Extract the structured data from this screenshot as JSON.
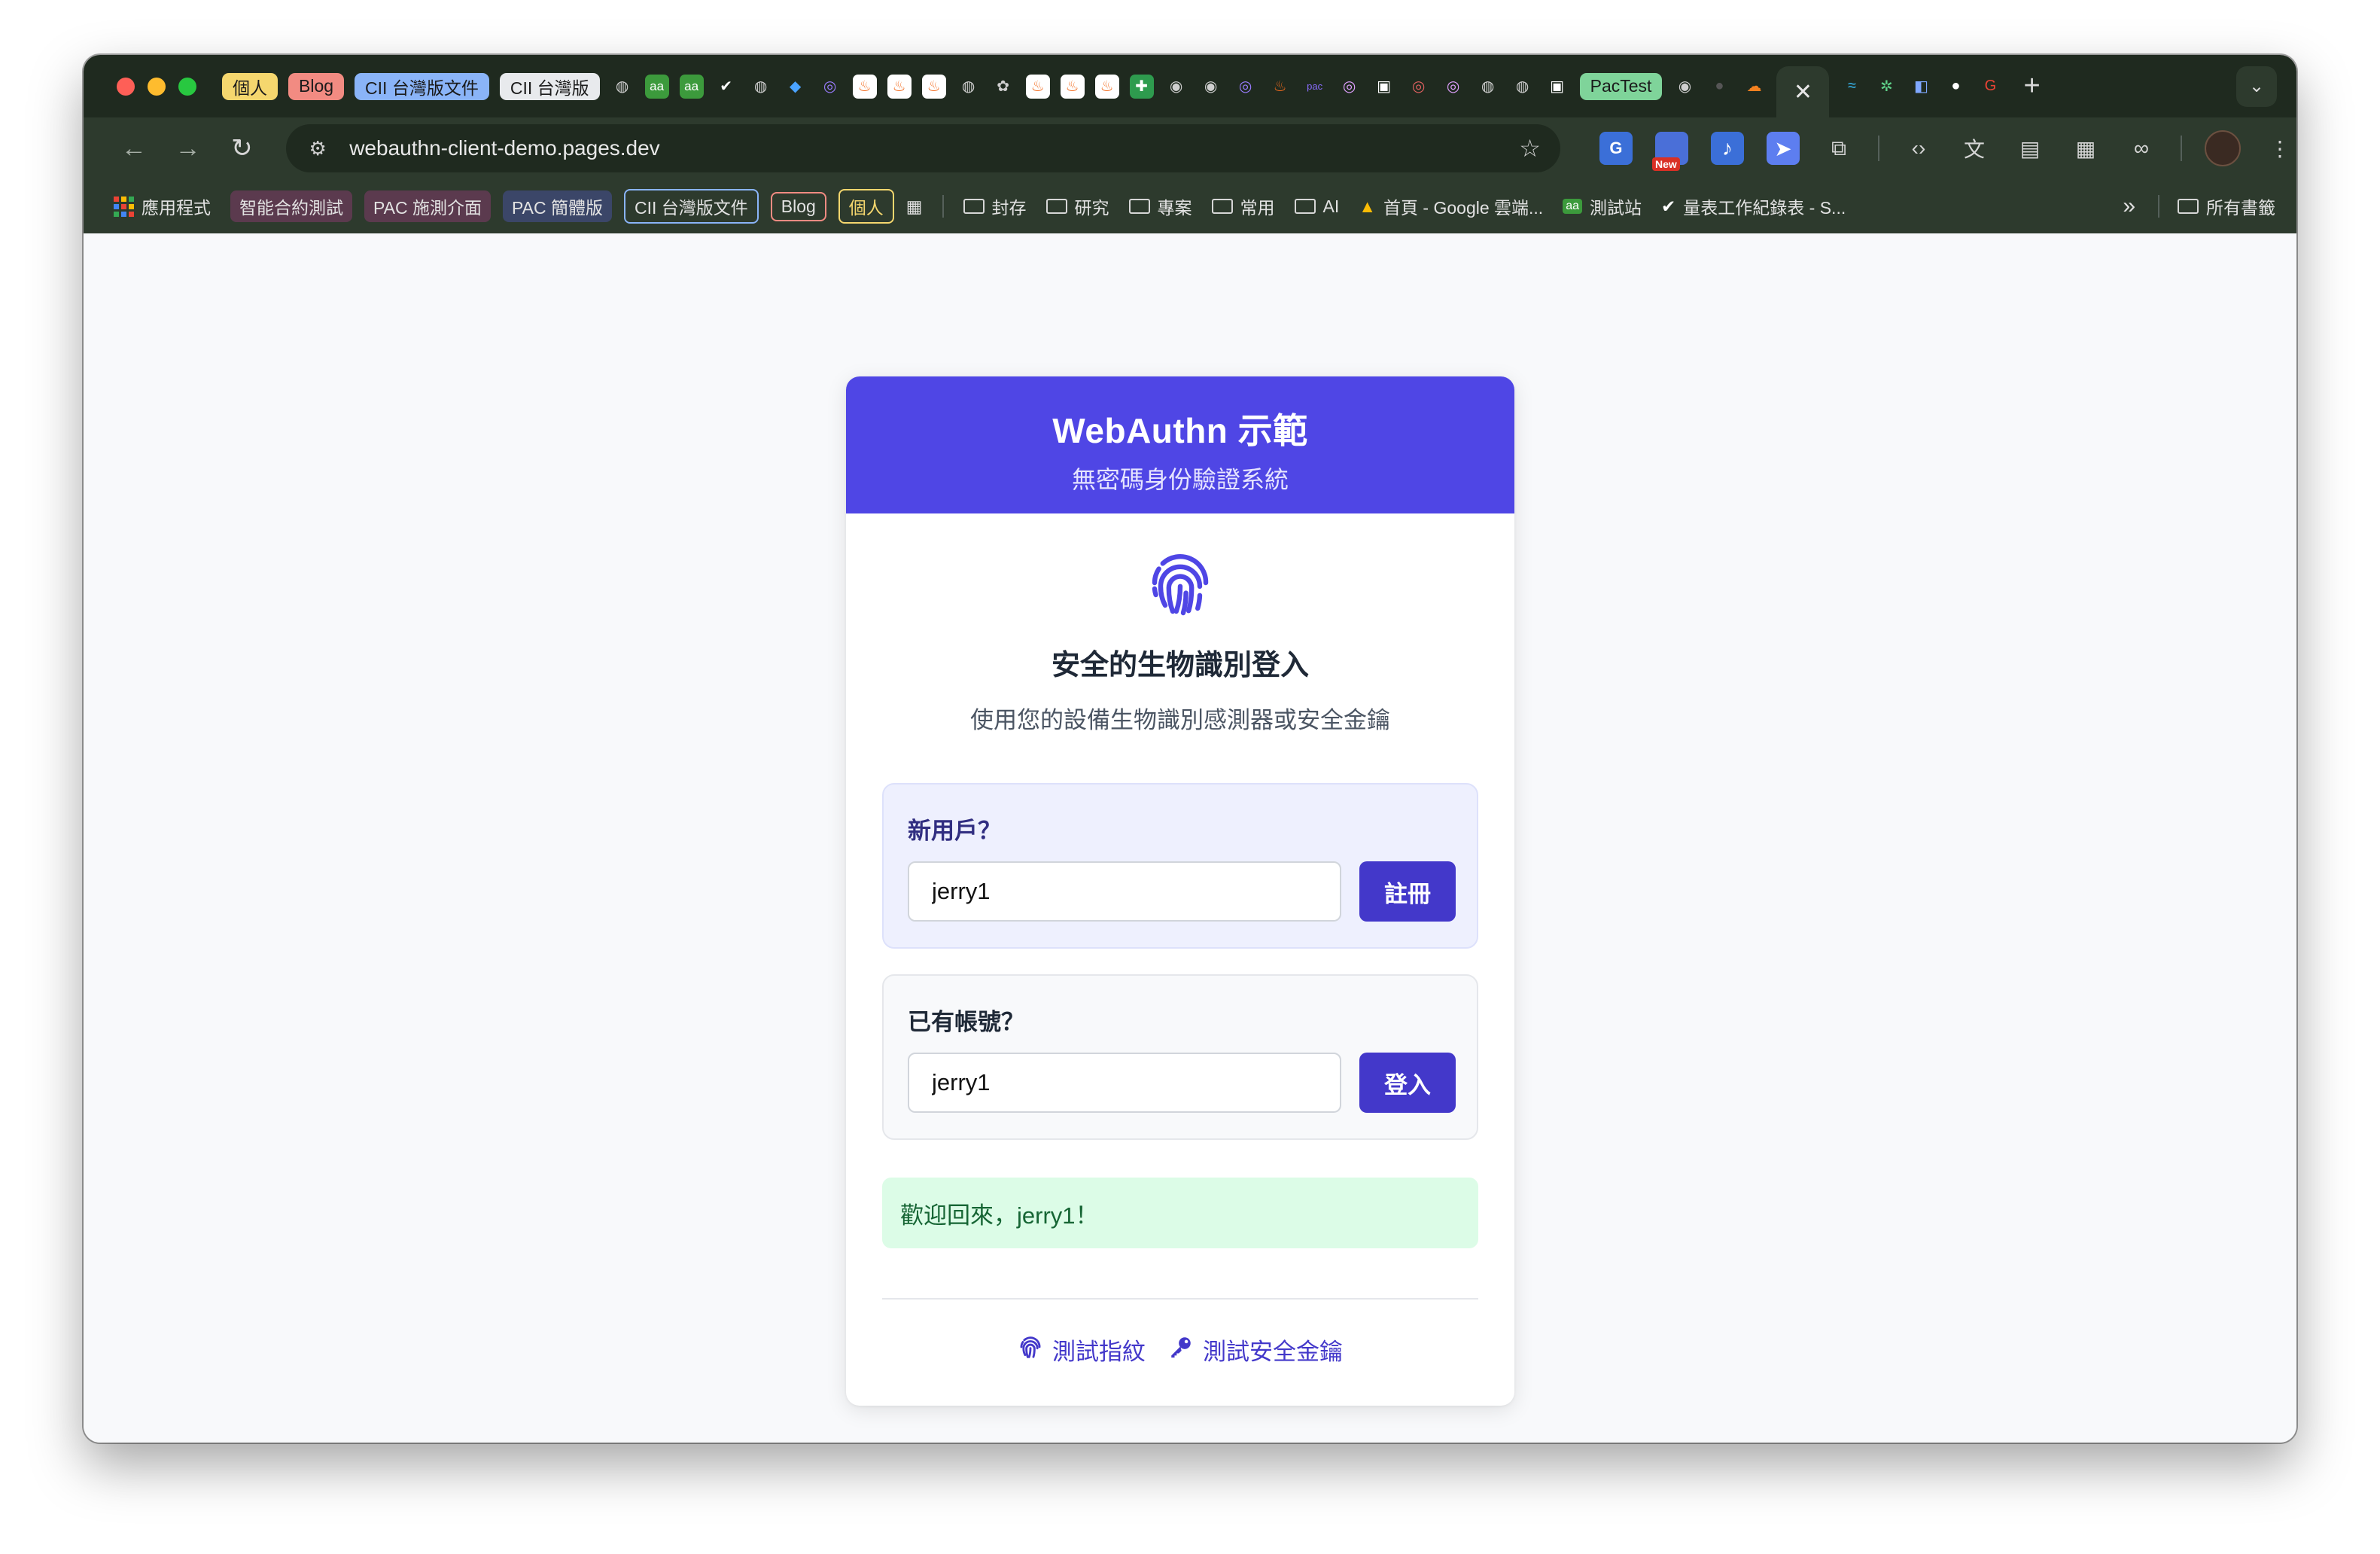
{
  "browser": {
    "colors": {
      "accent": "#4f46e5",
      "frame": "#1f2a1f",
      "toolbar": "#2d3a2d"
    },
    "tabs": {
      "group_chips": [
        {
          "label": "個人",
          "bg": "#f5d76e"
        },
        {
          "label": "Blog",
          "bg": "#f28b82"
        },
        {
          "label": "CII 台灣版文件",
          "bg": "#8ab4f8"
        },
        {
          "label": "CII 台灣版",
          "bg": "#e8eaed"
        }
      ],
      "pactest_label": "PacTest",
      "close_glyph": "✕",
      "new_tab_glyph": "+"
    },
    "address_bar": {
      "url": "webauthn-client-demo.pages.dev"
    },
    "extensions": {
      "new_badge": "New",
      "translate_label": "G"
    },
    "bookmarks": {
      "apps_label": "應用程式",
      "chips": [
        {
          "label": "智能合約測試",
          "bg": "#5b3a4e"
        },
        {
          "label": "PAC 施測介面",
          "bg": "#5b3a4e"
        },
        {
          "label": "PAC 簡體版",
          "bg": "#3b4668"
        },
        {
          "label": "CII 台灣版文件",
          "bg": "transparent",
          "border": "#8ab4f8"
        },
        {
          "label": "Blog",
          "bg": "transparent",
          "border": "#f28b82"
        },
        {
          "label": "個人",
          "bg": "transparent",
          "border": "#f5d76e"
        }
      ],
      "folders": [
        "封存",
        "研究",
        "專案",
        "常用",
        "AI"
      ],
      "links": [
        "首頁 - Google 雲端...",
        "測試站",
        "量表工作紀錄表 - S..."
      ],
      "overflow": "»",
      "all_bookmarks": "所有書籤"
    }
  },
  "app": {
    "header": {
      "title": "WebAuthn 示範",
      "subtitle": "無密碼身份驗證系統"
    },
    "hero": {
      "icon": "fingerprint-icon",
      "title": "安全的生物識別登入",
      "description": "使用您的設備生物識別感測器或安全金鑰"
    },
    "register": {
      "label": "新用戶？",
      "username_value": "jerry1",
      "button_label": "註冊"
    },
    "login": {
      "label": "已有帳號？",
      "username_value": "jerry1",
      "button_label": "登入"
    },
    "status_message": "歡迎回來，jerry1！",
    "footer_links": {
      "test_fingerprint": "測試指紋",
      "test_security_key": "測試安全金鑰"
    }
  }
}
